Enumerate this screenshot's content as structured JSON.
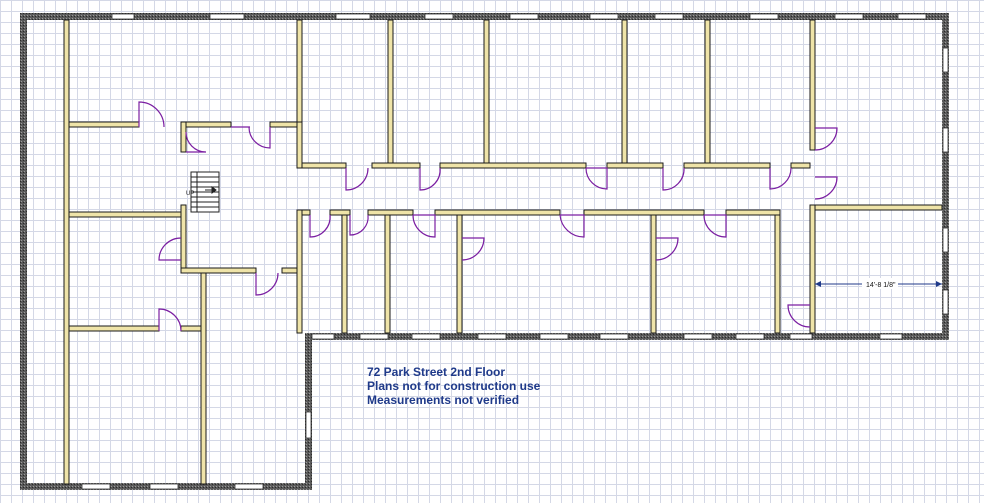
{
  "floor_plan": {
    "stair_label": "UP",
    "dimension_label": "14'-8 1/8\"",
    "notes": [
      "72 Park Street 2nd Floor",
      "Plans not for construction use",
      "Measurements not verified"
    ]
  },
  "colors": {
    "wall": "#3a3a3a",
    "wall_edge": "#1a1a1a",
    "interior_wall_fill": "#efe4a8",
    "door_swing": "#7b1fa2",
    "note_text": "#1f3a8a",
    "grid": "#d4d8e6"
  }
}
